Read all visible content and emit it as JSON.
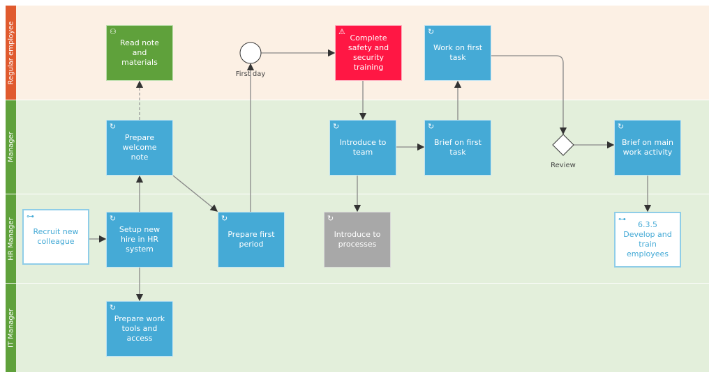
{
  "lanes": [
    {
      "id": "regular",
      "label": "Regular employee",
      "header_color": "#e05a2e",
      "bg": "#fcf0e4"
    },
    {
      "id": "manager",
      "label": "Manager",
      "header_color": "#5fa13b",
      "bg": "#e3efdb"
    },
    {
      "id": "hr",
      "label": "HR Manager",
      "header_color": "#5fa13b",
      "bg": "#e3efdb"
    },
    {
      "id": "it",
      "label": "IT Manager",
      "header_color": "#5fa13b",
      "bg": "#e3efdb"
    }
  ],
  "nodes": [
    {
      "id": "read",
      "label": "Read note and materials",
      "kind": "green",
      "icon": "user-task-icon"
    },
    {
      "id": "welcome",
      "label": "Prepare welcome note",
      "kind": "task",
      "icon": "loop-icon"
    },
    {
      "id": "recruit",
      "label": "Recruit new colleague",
      "kind": "sub",
      "icon": "subprocess-icon"
    },
    {
      "id": "setup",
      "label": "Setup new hire in HR system",
      "kind": "task",
      "icon": "loop-icon"
    },
    {
      "id": "tools",
      "label": "Prepare work tools and access",
      "kind": "task",
      "icon": "loop-icon"
    },
    {
      "id": "period",
      "label": "Prepare first period",
      "kind": "task",
      "icon": "loop-icon"
    },
    {
      "id": "safety",
      "label": "Complete safety and security training",
      "kind": "red",
      "icon": "warning-icon"
    },
    {
      "id": "team",
      "label": "Introduce to team",
      "kind": "task",
      "icon": "loop-icon"
    },
    {
      "id": "processes",
      "label": "Introduce to processes",
      "kind": "gray",
      "icon": "loop-icon"
    },
    {
      "id": "work",
      "label": "Work on first task",
      "kind": "task",
      "icon": "loop-icon"
    },
    {
      "id": "brief1",
      "label": "Brief on first task",
      "kind": "task",
      "icon": "loop-icon"
    },
    {
      "id": "briefmain",
      "label": "Brief on main work activity",
      "kind": "task",
      "icon": "loop-icon"
    },
    {
      "id": "develop",
      "label": "6.3.5 Develop and train employees",
      "kind": "sub",
      "icon": "subprocess-icon"
    }
  ],
  "events": {
    "start_label": "First day",
    "gateway_label": "Review"
  }
}
